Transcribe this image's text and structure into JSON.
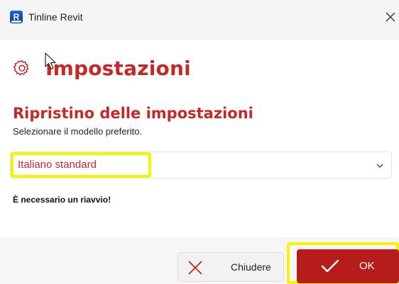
{
  "window": {
    "title": "Tinline Revit",
    "app_icon_letter": "R"
  },
  "page": {
    "title": "Impostazioni",
    "icon": "gear-icon"
  },
  "section": {
    "title": "Ripristino delle impostazioni",
    "description": "Selezionare il modello preferito."
  },
  "template_select": {
    "selected": "Italiano standard",
    "icon": "chevron-down-icon"
  },
  "restart_note": "È necessario un riavvio!",
  "buttons": {
    "close_label": "Chiudere",
    "ok_label": "OK"
  },
  "colors": {
    "accent": "#c62828",
    "ok_button": "#b71c1c",
    "highlight": "#f5f500"
  }
}
